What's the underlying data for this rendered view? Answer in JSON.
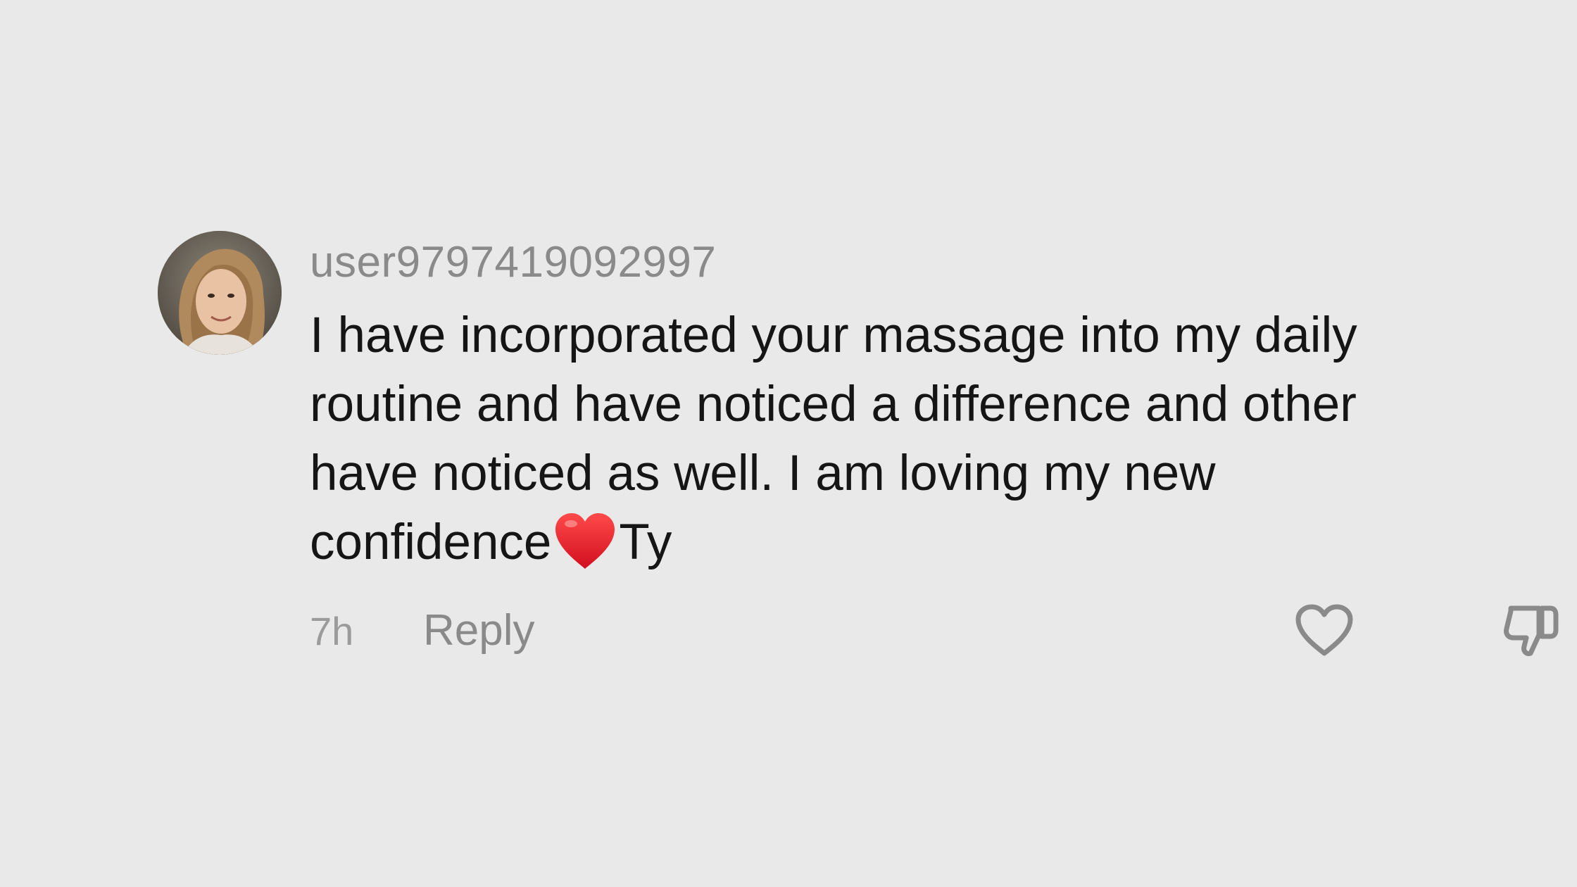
{
  "comment": {
    "username": "user9797419092997",
    "text_before_emoji": "I have incorporated your massage into my daily routine and have noticed a difference and other have noticed as well. I am loving my new confidence",
    "emoji": "red-heart-emoji",
    "text_after_emoji": "Ty",
    "timestamp": "7h",
    "reply_label": "Reply",
    "like_icon": "heart-outline-icon",
    "dislike_icon": "thumbs-down-icon"
  },
  "colors": {
    "background": "#e9e9e9",
    "username": "#8a8a8a",
    "text": "#151515",
    "meta": "#9b9b9b",
    "heart_emoji": "#e0182d"
  }
}
